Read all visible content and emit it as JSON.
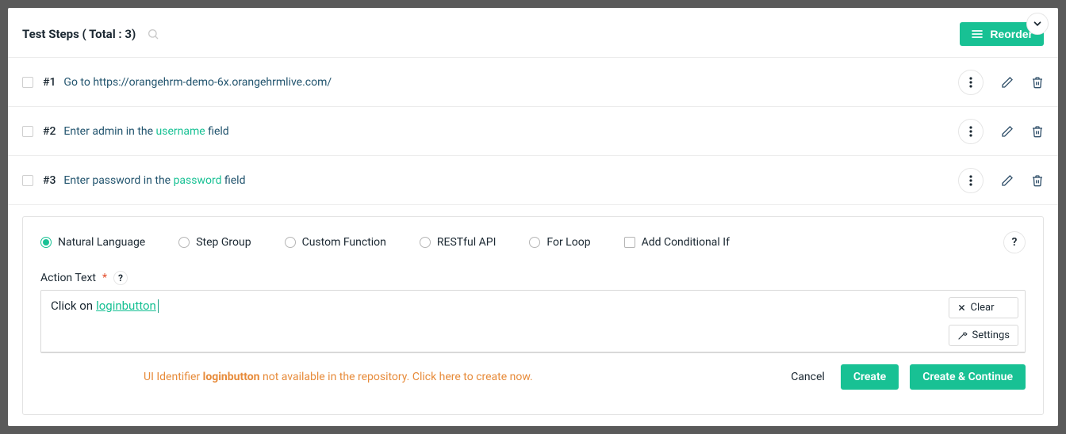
{
  "header": {
    "title": "Test Steps ( Total : 3)",
    "reorder_label": "Reorder"
  },
  "steps": [
    {
      "num": "#1",
      "prefix": "Go to ",
      "url": "https://orangehrm-demo-6x.orangehrmlive.com/"
    },
    {
      "num": "#2",
      "p1": "Enter ",
      "val": "admin",
      "p2": " in the ",
      "uiid": "username",
      "p3": " field"
    },
    {
      "num": "#3",
      "p1": "Enter ",
      "val": "password",
      "p2": " in the ",
      "uiid": "password",
      "p3": " field"
    }
  ],
  "editor": {
    "types": {
      "nl": "Natural Language",
      "sg": "Step Group",
      "cf": "Custom Function",
      "rest": "RESTful API",
      "for": "For Loop",
      "cond": "Add Conditional If"
    },
    "help": "?",
    "action_label": "Action Text",
    "req": "*",
    "action_prefix": "Click on ",
    "action_token": "loginbutton",
    "clear": "Clear",
    "settings": "Settings",
    "warn_p1": "UI Identifier ",
    "warn_bold": "loginbutton",
    "warn_p2": " not available in the repository. Click here to create now."
  },
  "footer": {
    "cancel": "Cancel",
    "create": "Create",
    "create_continue": "Create & Continue"
  }
}
